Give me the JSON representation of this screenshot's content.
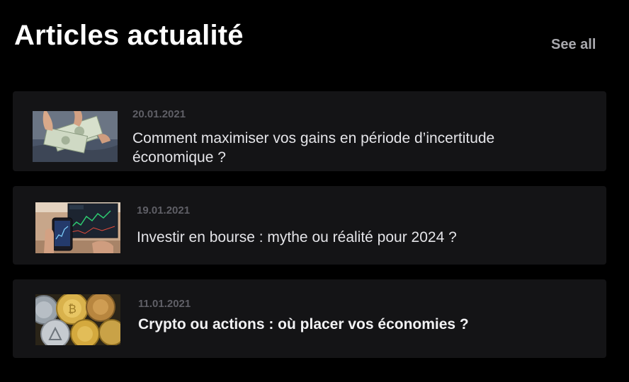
{
  "header": {
    "title": "Articles actualité",
    "see_all_label": "See all"
  },
  "articles": [
    {
      "date": "20.01.2021",
      "title": "Comment maximiser vos gains en période d’incertitude économique ?",
      "image": "money-cash-icon"
    },
    {
      "date": "19.01.2021",
      "title": "Investir en bourse : mythe ou réalité pour 2024 ?",
      "image": "stock-trading-phone-icon"
    },
    {
      "date": "11.01.2021",
      "title": "Crypto ou actions : où placer vos économies ?",
      "image": "crypto-coins-icon"
    }
  ],
  "colors": {
    "background": "#000000",
    "card": "#141416",
    "title": "#ffffff",
    "see_all": "#a9a9ae",
    "date": "#5f5f66",
    "headline": "#e4e4e8"
  }
}
